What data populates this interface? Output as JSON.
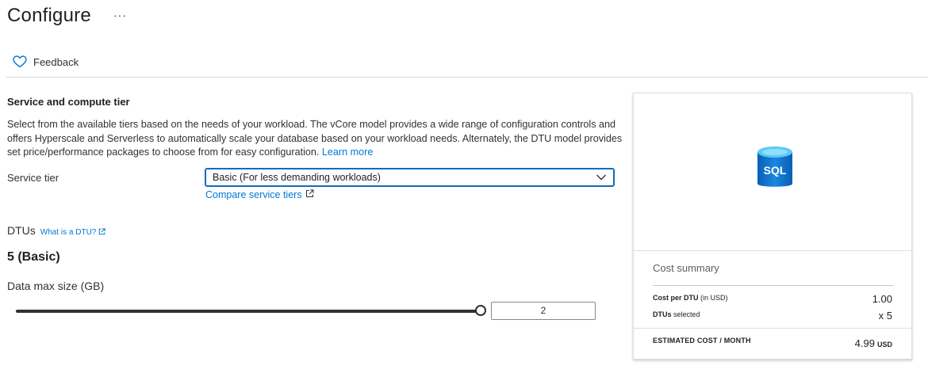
{
  "header": {
    "title": "Configure",
    "more_label": "···",
    "feedback_label": "Feedback"
  },
  "service": {
    "section_title": "Service and compute tier",
    "description": "Select from the available tiers based on the needs of your workload. The vCore model provides a wide range of configuration controls and offers Hyperscale and Serverless to automatically scale your database based on your workload needs. Alternately, the DTU model provides set price/performance packages to choose from for easy configuration.",
    "learn_more": "Learn more",
    "tier_label": "Service tier",
    "tier_value": "Basic (For less demanding workloads)",
    "compare_link": "Compare service tiers"
  },
  "dtu": {
    "label": "DTUs",
    "what_link": "What is a DTU?",
    "value": "5 (Basic)"
  },
  "data_size": {
    "label": "Data max size (GB)",
    "value": "2",
    "slider_fraction": 1.0
  },
  "cost": {
    "title": "Cost summary",
    "icon_text": "SQL",
    "rows": [
      {
        "label": "Cost per DTU",
        "note": "(in USD)",
        "value": "1.00"
      },
      {
        "label": "DTUs",
        "note": "selected",
        "value": "x 5"
      }
    ],
    "estimated_label": "ESTIMATED COST / MONTH",
    "estimated_value": "4.99",
    "estimated_unit": "USD"
  },
  "colors": {
    "accent": "#0078d4",
    "select_border": "#0f6cbd",
    "text": "#323130"
  }
}
